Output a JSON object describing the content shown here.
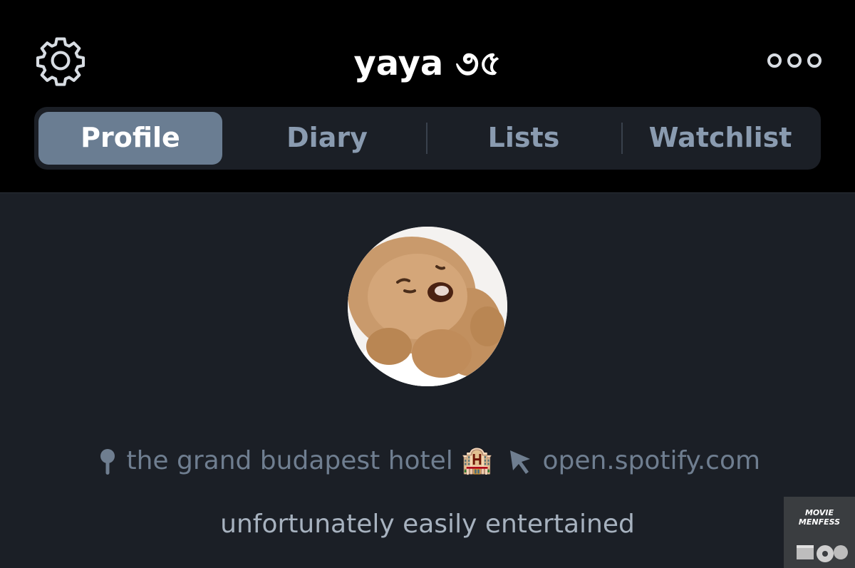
{
  "header": {
    "title": "yaya ૭৫",
    "settings_icon": "gear-icon",
    "more_icon": "more-options-icon"
  },
  "tabs": [
    {
      "label": "Profile",
      "active": true
    },
    {
      "label": "Diary",
      "active": false
    },
    {
      "label": "Lists",
      "active": false
    },
    {
      "label": "Watchlist",
      "active": false
    }
  ],
  "profile": {
    "avatar": "plush-toy-avatar",
    "location": "the grand budapest hotel 🏨",
    "location_icon": "location-pin-icon",
    "website": "open.spotify.com",
    "website_icon": "cursor-arrow-icon",
    "bio": "unfortunately easily entertained"
  },
  "watermark": {
    "text": "MOVIE MENFESS"
  },
  "colors": {
    "header_bg": "#000000",
    "page_bg": "#1b1f26",
    "tab_active_bg": "#6a7d92",
    "tab_inactive_text": "#8a9bb0",
    "meta_text": "#6f7e90",
    "bio_text": "#a7b2bf"
  }
}
